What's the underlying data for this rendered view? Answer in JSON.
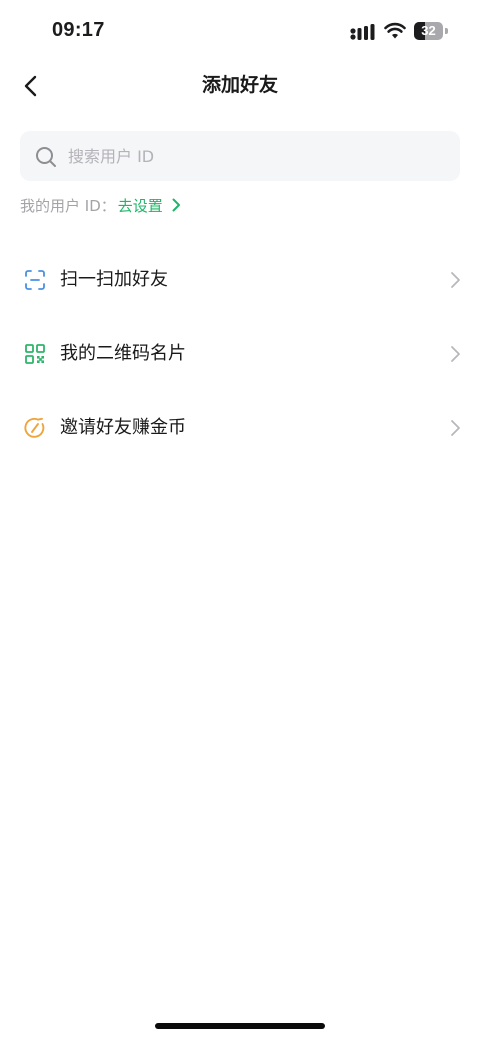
{
  "status_bar": {
    "time": "09:17",
    "battery_level": "32",
    "icons": [
      "signal-icon",
      "wifi-icon",
      "battery-icon"
    ]
  },
  "nav": {
    "title": "添加好友",
    "back_icon": "chevron-left-icon"
  },
  "search": {
    "placeholder": "搜索用户 ID",
    "value": "",
    "icon": "search-icon"
  },
  "user_id": {
    "label": "我的用户 ID：",
    "link_label": "去设置",
    "link_icon": "chevron-right-icon"
  },
  "menu": {
    "items": [
      {
        "label": "扫一扫加好友",
        "icon": "scan-icon",
        "color": "#4a90e2"
      },
      {
        "label": "我的二维码名片",
        "icon": "qr-code-icon",
        "color": "#2db56a"
      },
      {
        "label": "邀请好友赚金币",
        "icon": "coin-icon",
        "color": "#f0a53a"
      }
    ]
  },
  "colors": {
    "accent_green": "#1fb567",
    "muted_text": "#a4a4a8",
    "search_bg": "#f5f6f8"
  }
}
